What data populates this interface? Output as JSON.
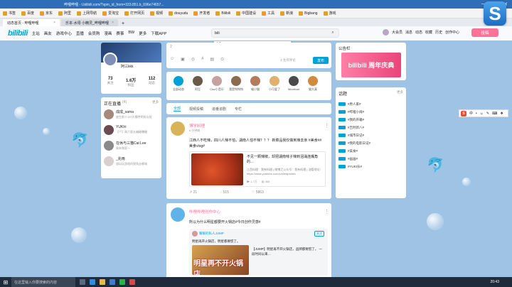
{
  "browser": {
    "title": "哔哩哔哩 - t.bilibili.com/?spm_id_from=333.851.b_696e74657...",
    "window_controls": [
      "—",
      "□",
      "✕"
    ],
    "brand_letter": "S"
  },
  "bookmarks": [
    "书签",
    "百度",
    "京东",
    "阿里",
    "上网导航",
    "爱淘宝",
    "打开网页",
    "视频",
    "douyudu",
    "开发者",
    "Bilibili",
    "中国建设",
    "工具",
    "新浪",
    "Bigbang",
    "游戏"
  ],
  "tabs": [
    {
      "label": "动态首页 - 哔哩哔哩",
      "active": true
    },
    {
      "label": "乐本·水母 小精灵_哔哩哔哩",
      "active": false
    }
  ],
  "nav": {
    "logo": "bilibili",
    "links": [
      "主站",
      "画友",
      "游戏中心",
      "直播",
      "会员购",
      "漫画",
      "赛事",
      "BW",
      "更多",
      "下载APP"
    ],
    "search_value": "bili",
    "search_icon": "search-icon",
    "right": [
      "大会员",
      "消息",
      "动态",
      "收藏",
      "历史",
      "创作中心"
    ],
    "upload": "投稿"
  },
  "ime": {
    "typed": "bili",
    "candidates": [
      "1 城",
      "2 彪",
      "3 实",
      "4 深",
      "5 bìn",
      "‹",
      "›"
    ],
    "bar": [
      "中",
      "•",
      "☺",
      "✎",
      "⌨",
      "❖"
    ]
  },
  "profile": {
    "name": "阿三kkk",
    "stats": [
      {
        "value": "73",
        "label": "关注"
      },
      {
        "value": "1.6万",
        "label": "粉丝"
      },
      {
        "value": "112",
        "label": "动态"
      }
    ]
  },
  "live": {
    "title": "正在直播",
    "count": "(4)",
    "more": "更多",
    "items": [
      {
        "name": "成成_sama",
        "desc": "放生前十120大模特明所以呢",
        "color": "#a58a7a"
      },
      {
        "name": "YUKIri",
        "desc": "【个】周六版五编硬曝硬",
        "color": "#6b4a52"
      },
      {
        "name": "在休与三猫Cat Lee",
        "desc": "周末和家一",
        "color": "#8a8a8a"
      },
      {
        "name": "_兆雨",
        "desc": "游玩玩游戏的视角去哪城",
        "color": "#d7cfd0"
      }
    ]
  },
  "composer": {
    "placeholder": "2",
    "counter": "1 允许评论",
    "publish": "发布"
  },
  "ups": [
    {
      "name": "全部动态",
      "color": "#00a1d6"
    },
    {
      "name": "阿豆",
      "color": "#6a5848"
    },
    {
      "name": "Cisz小音乐",
      "color": "#c9a0a0"
    },
    {
      "name": "我是钩钩钩",
      "color": "#8a6b4e"
    },
    {
      "name": "喵小猫",
      "color": "#b37a5c"
    },
    {
      "name": "小可爱了",
      "color": "#e0b070"
    },
    {
      "name": "Mixottost",
      "color": "#4a4a4a"
    },
    {
      "name": "猫大真",
      "color": "#d28a40"
    }
  ],
  "filters": [
    "全部",
    "视频投稿",
    "追番追剧",
    "专栏"
  ],
  "post1": {
    "author": "博学料理",
    "time": "6 分钟前",
    "text": "江西人不吃辣，四川人辣不怕，湖南人怕不辣？？？ 新菜品我仅做到辣去亲 #美食## 美食vlog#",
    "video_title": "不见一颗辣椒，却把湖南味子辣到泪涌连嘴角的…",
    "video_desc": "江西料理：我有料理 | 微博之公众号：我有料理 | 油管地址：https://www.youtube.com/c/sheaproteh",
    "plays": "1.7万",
    "danmaku": "465",
    "actions": [
      "21",
      "515",
      "5863"
    ]
  },
  "post2": {
    "author": "哔哩哔哩创作中心",
    "text": "所以为什么明星都要开火锅店#今日创作灵感#",
    "repost_author": "暖暖的私人JUMP",
    "repost_follow": "关注",
    "repost_text": "明星再开火锅店，明星都要慌了。",
    "thumb_overlay": "明星再不开火锅店",
    "repost_desc": "【JUMP】明星再不开火锅店，品牌都要慌了。 一段时间以来…"
  },
  "notice": {
    "title": "公告栏",
    "banner": "bilibili 周年庆典"
  },
  "topics": {
    "title": "话题",
    "more": "更多",
    "items": [
      "#原人家#",
      "#哔哩小闹#",
      "#我的开箱#",
      "#吉时新八#",
      "#城市日记#",
      "#我的电影日记#",
      "#美食#",
      "#画画#",
      "#YUKI乐#"
    ]
  },
  "taskbar": {
    "search": "在这里输入你要搜索的内容",
    "clock": "20:43"
  }
}
